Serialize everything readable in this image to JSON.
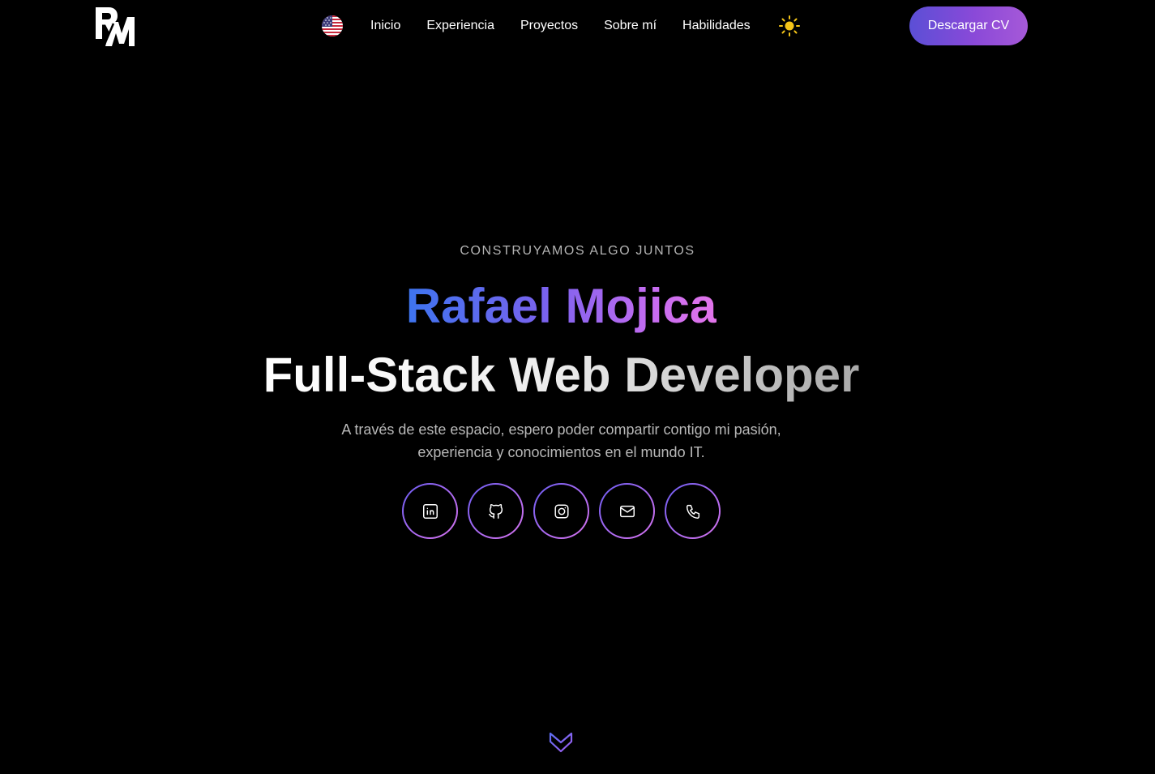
{
  "header": {
    "logo_text": "RM",
    "language_flag": "us-flag-icon",
    "nav": [
      {
        "label": "Inicio"
      },
      {
        "label": "Experiencia"
      },
      {
        "label": "Proyectos"
      },
      {
        "label": "Sobre mí"
      },
      {
        "label": "Habilidades"
      }
    ],
    "theme_icon": "sun-icon",
    "cv_button": "Descargar CV"
  },
  "hero": {
    "eyebrow": "CONSTRUYAMOS ALGO JUNTOS",
    "name": "Rafael Mojica",
    "role": "Full-Stack Web Developer",
    "description_line1": "A través de este espacio, espero poder compartir contigo mi pasión,",
    "description_line2": "experiencia y conocimientos en el mundo IT.",
    "socials": [
      {
        "icon": "linkedin-icon"
      },
      {
        "icon": "github-icon"
      },
      {
        "icon": "instagram-icon"
      },
      {
        "icon": "mail-icon"
      },
      {
        "icon": "phone-icon"
      }
    ],
    "scroll_icon": "chevron-down-icon"
  },
  "colors": {
    "background": "#000000",
    "accent_blue": "#3d74ef",
    "accent_purple": "#8a49d8",
    "accent_pink": "#e274ea",
    "sun": "#f5c518"
  }
}
